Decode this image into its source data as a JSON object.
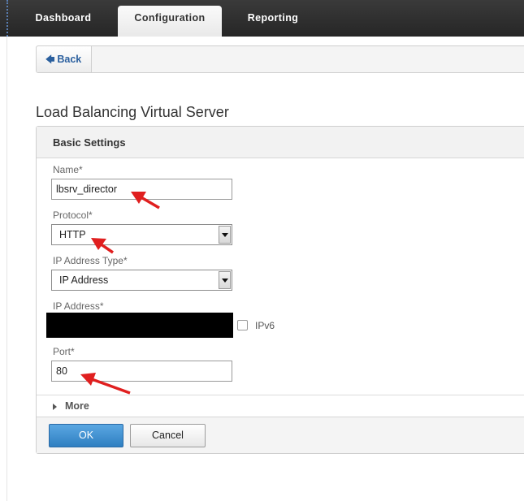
{
  "nav": {
    "tabs": [
      {
        "label": "Dashboard"
      },
      {
        "label": "Configuration"
      },
      {
        "label": "Reporting"
      }
    ]
  },
  "toolbar": {
    "back_label": "Back",
    "back_icon": "arrow-left-icon"
  },
  "page": {
    "title": "Load Balancing Virtual Server"
  },
  "basic_settings": {
    "header": "Basic Settings",
    "name": {
      "label": "Name*",
      "value": "lbsrv_director"
    },
    "protocol": {
      "label": "Protocol*",
      "value": "HTTP"
    },
    "ip_address_type": {
      "label": "IP Address Type*",
      "value": "IP Address"
    },
    "ip_address": {
      "label": "IP Address*"
    },
    "ipv6": {
      "label": "IPv6",
      "checked": false
    },
    "port": {
      "label": "Port*",
      "value": "80"
    },
    "more_label": "More"
  },
  "actions": {
    "ok_label": "OK",
    "cancel_label": "Cancel"
  },
  "colors": {
    "topbar": "#2e2e2e",
    "primary_button": "#3d8fd0",
    "link": "#2a5f9e",
    "annotation_arrow": "#e01f1f"
  }
}
